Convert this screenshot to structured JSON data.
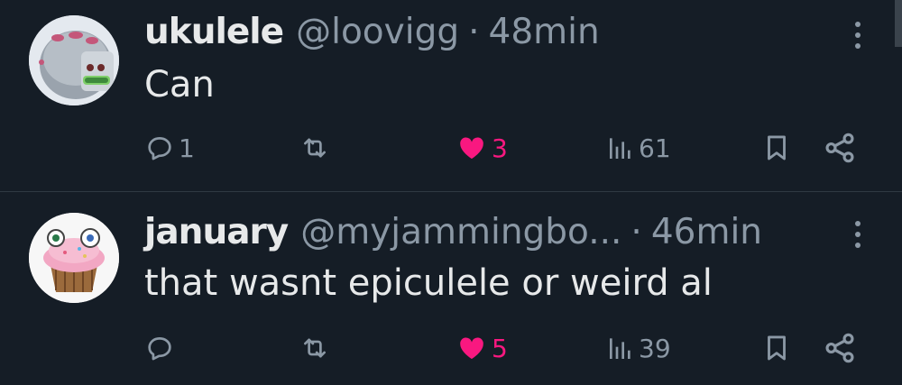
{
  "posts": [
    {
      "name": "ukulele",
      "handle": "@loovigg",
      "dot": "·",
      "time": "48min",
      "text": "Can",
      "reply_count": "1",
      "repost_count": "",
      "like_count": "3",
      "view_count": "61",
      "avatar_icon": "monster-avatar-icon"
    },
    {
      "name": "january",
      "handle": "@myjammingbo...",
      "dot": "·",
      "time": "46min",
      "text": "that wasnt epiculele or weird al",
      "reply_count": "",
      "repost_count": "",
      "like_count": "5",
      "view_count": "39",
      "avatar_icon": "cupcake-avatar-icon"
    }
  ],
  "colors": {
    "background": "#151d26",
    "text": "#e7e9ea",
    "muted": "#8b98a5",
    "like": "#f91880",
    "divider": "#2f3942"
  },
  "icons": [
    "reply-icon",
    "repost-icon",
    "heart-icon",
    "views-icon",
    "bookmark-icon",
    "share-icon",
    "more-icon"
  ]
}
